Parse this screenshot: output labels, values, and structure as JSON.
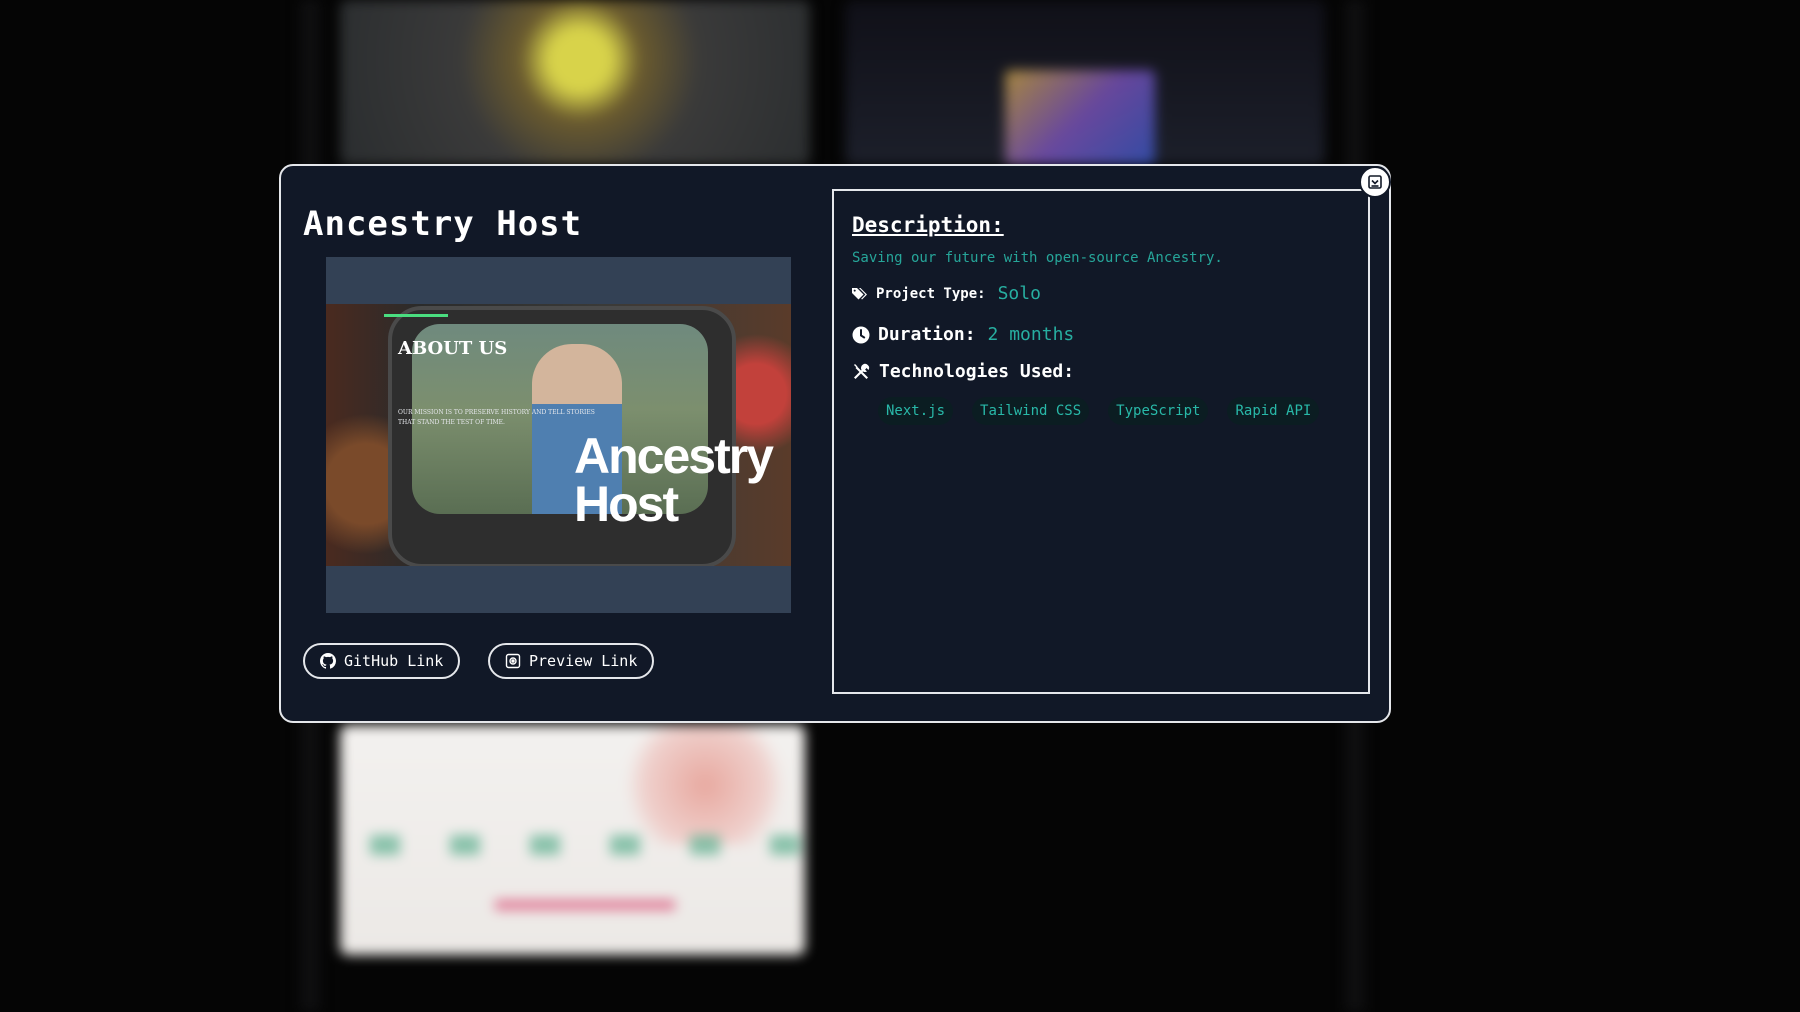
{
  "modal": {
    "title": "Ancestry Host",
    "preview": {
      "heading": "ABOUT US",
      "mission": "OUR MISSION IS TO PRESERVE HISTORY AND TELL STORIES THAT STAND THE TEST OF TIME.",
      "brand_line1": "Ancestry",
      "brand_line2": "Host"
    },
    "buttons": {
      "github_label": "GitHub Link",
      "preview_label": "Preview Link"
    },
    "description": {
      "heading": "Description:",
      "text": "Saving our future with open-source Ancestry.",
      "project_type_label": "Project Type:",
      "project_type_value": "Solo",
      "duration_label": "Duration:",
      "duration_value": "2 months",
      "technologies_label": "Technologies Used:",
      "technologies": [
        "Next.js",
        "Tailwind CSS",
        "TypeScript",
        "Rapid API"
      ]
    }
  },
  "colors": {
    "modal_bg": "#111827",
    "accent": "#2dd4bf",
    "border": "#e5e7eb",
    "preview_bg": "#334155"
  },
  "icons": [
    "github-icon",
    "preview-icon",
    "tag-icon",
    "clock-icon",
    "tools-icon",
    "close-icon"
  ]
}
